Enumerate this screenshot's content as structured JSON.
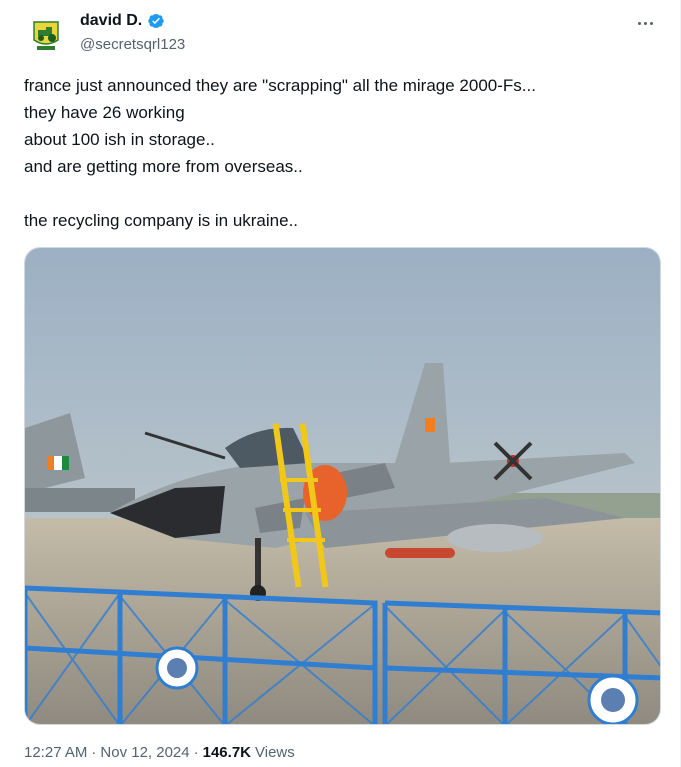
{
  "author": {
    "display_name": "david D.",
    "handle": "@secretsqrl123",
    "verified": true,
    "avatar_icon": "tractor-logo-avatar"
  },
  "tweet": {
    "text": "france just announced they are \"scrapping\" all the mirage 2000-Fs...\nthey have 26 working\nabout 100 ish in storage..\nand are getting more from overseas..\n\nthe recycling company is in ukraine..",
    "media_description_icon": "mirage-2000-jet-photo"
  },
  "meta": {
    "time": "12:27 AM",
    "separator": "·",
    "date": "Nov 12, 2024",
    "views_count": "146.7K",
    "views_label": "Views"
  },
  "colors": {
    "verified_blue": "#1d9bf0",
    "text_primary": "#0f1419",
    "text_secondary": "#536471"
  }
}
